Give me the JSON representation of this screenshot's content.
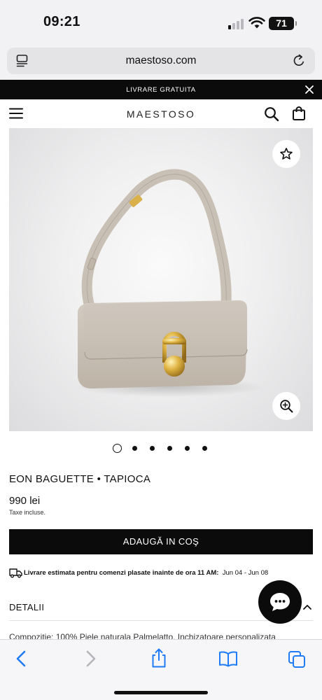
{
  "status_bar": {
    "time": "09:21",
    "battery": "71"
  },
  "browser": {
    "url": "maestoso.com"
  },
  "promo": {
    "text": "LIVRARE GRATUITA"
  },
  "header": {
    "brand": "MAESTOSO"
  },
  "carousel": {
    "total_images": 6,
    "active_index": 0
  },
  "product": {
    "title": "EON BAGUETTE • TAPIOCA",
    "price": "990 lei",
    "tax_note": "Taxe incluse.",
    "add_to_cart_label": "ADAUGĂ IN COŞ",
    "delivery_prefix": "Livrare estimata pentru comenzi plasate inainte de ora 11 AM:",
    "delivery_dates": "Jun 04 - Jun 08",
    "details_label": "DETALII",
    "composition": "Compozitie: 100% Piele naturala Palmelatto. Inchizatoare personalizata"
  },
  "colors": {
    "accent": "#0b0b0b",
    "ios_blue": "#1f7bf6",
    "bag_leather": "#c8bfb4",
    "hardware_gold": "#d4a63a"
  },
  "icons": [
    "reader-icon",
    "reload-icon",
    "close-icon",
    "menu-icon",
    "search-icon",
    "bag-icon",
    "star-icon",
    "zoom-in-icon",
    "truck-icon",
    "chat-icon",
    "chevron-up-icon",
    "back-icon",
    "forward-icon",
    "share-icon",
    "bookmarks-icon",
    "tabs-icon"
  ]
}
